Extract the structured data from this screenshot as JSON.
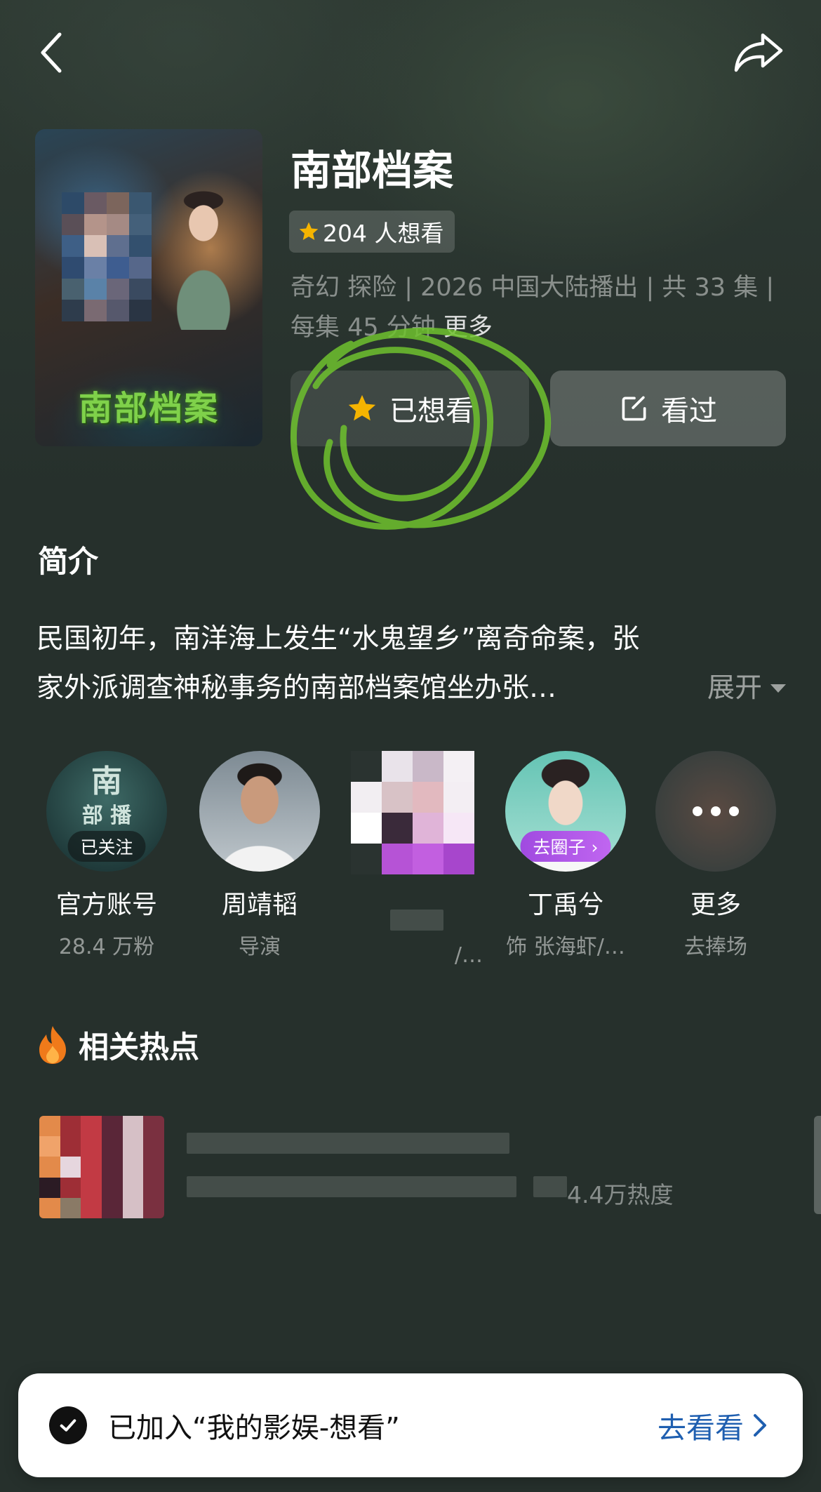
{
  "header": {
    "back_icon": "chevron-left-icon",
    "share_icon": "share-arrow-icon"
  },
  "show": {
    "poster_title": "南部档案",
    "title": "南部档案",
    "want_count": "204 人想看",
    "meta_text": "奇幻 探险 | 2026 中国大陆播出 |  共 33 集 | 每集 45 分钟 ",
    "meta_more": "更多"
  },
  "actions": {
    "want_label": "已想看",
    "seen_label": "看过"
  },
  "intro": {
    "heading": "简介",
    "line1": "民国初年，南洋海上发生“水鬼望乡”离奇命案，张",
    "line2": "家外派调查神秘事务的南部档案馆坐办张…",
    "expand_label": "展开"
  },
  "cast": [
    {
      "name": "官方账号",
      "role": "28.4 万粉",
      "badge": "已关注"
    },
    {
      "name": "周靖韬",
      "role": "导演"
    },
    {
      "name": "",
      "role": "/…"
    },
    {
      "name": "丁禹兮",
      "role": "饰 张海虾/…",
      "badge": "去圈子 ›"
    },
    {
      "name": "更多",
      "role": "去捧场"
    }
  ],
  "hot": {
    "heading": "相关热点",
    "metric": "4.4万热度"
  },
  "toast": {
    "text": "已加入“我的影娱-想看”",
    "link_label": "去看看"
  },
  "colors": {
    "background": "#26302c",
    "link_blue": "#1f5fb0",
    "star_yellow": "#f5b400",
    "scribble_green": "#6fc22e"
  }
}
